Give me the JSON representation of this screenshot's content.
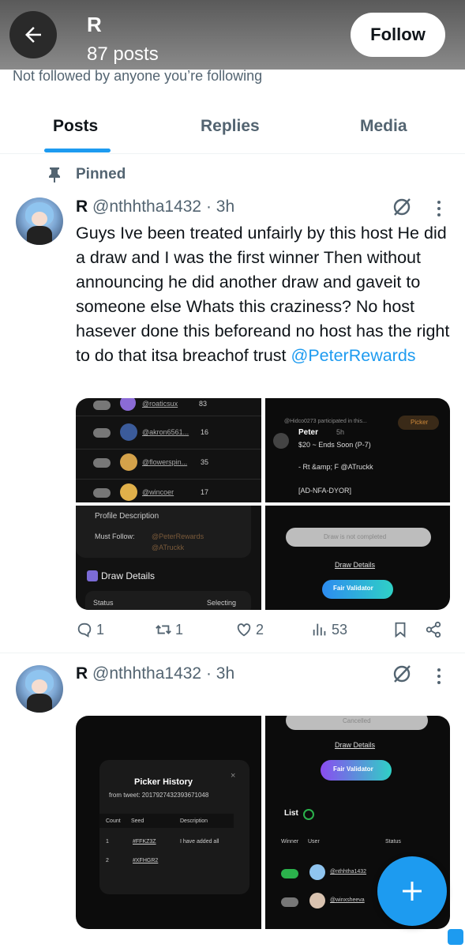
{
  "header": {
    "name": "R",
    "posts_count": "87 posts",
    "follow_label": "Follow",
    "not_followed": "Not followed by anyone you’re following"
  },
  "tabs": [
    {
      "label": "Posts",
      "active": true
    },
    {
      "label": "Replies",
      "active": false
    },
    {
      "label": "Media",
      "active": false
    }
  ],
  "pinned_label": "Pinned",
  "post1": {
    "name": "R",
    "handle_time": "@nthhtha1432 · 3h",
    "text": "Guys Ive been treated unfairly by this host He did a draw and I was the first winner Then without announcing he did another draw and gaveit to someone else Whats this craziness? No host hasever done this beforeand no host has the right to do that itsa breachof trust",
    "mention": "@PeterRewards",
    "media": {
      "list_users": [
        {
          "name": "@roaticsux",
          "count": "83"
        },
        {
          "name": "@akron6561...",
          "count": "16"
        },
        {
          "name": "@flowerspin...",
          "count": "35"
        },
        {
          "name": "@wincoer",
          "count": "17"
        }
      ],
      "participated": "@Hidco0273 participated in this...",
      "picker_label": "Picker",
      "peter_name": "Peter",
      "peter_time": "5h",
      "prize_line": "$20 ~ Ends Soon (P-7)",
      "rt_line": "- Rt &amp; F @ATruckk",
      "tag_line": "[AD-NFA-DYOR]",
      "profile_desc": "Profile Description",
      "must_follow_label": "Must Follow:",
      "must_follow_1": "@PeterRewards",
      "must_follow_2": "@ATruckk",
      "draw_details_title": "Draw Details",
      "status_label": "Status",
      "status_value": "Selecting",
      "draw_not_completed": "Draw is not completed",
      "draw_details_link": "Draw Details",
      "fair_validator": "Fair Validator"
    },
    "actions": {
      "replies": "1",
      "reposts": "1",
      "likes": "2",
      "views": "53"
    }
  },
  "post2": {
    "name": "R",
    "handle_time": "@nthhtha1432 · 3h",
    "media": {
      "picker_history_title": "Picker History",
      "from_tweet": "from tweet: 2017927432393671048",
      "col_count": "Count",
      "col_seed": "Seed",
      "col_desc": "Description",
      "rows": [
        {
          "count": "1",
          "seed": "#FFKZ3Z",
          "desc": "I have added all"
        },
        {
          "count": "2",
          "seed": "#XFHGR2",
          "desc": ""
        }
      ],
      "cancelled": "Cancelled",
      "draw_details_link": "Draw Details",
      "fair_validator": "Fair Validator",
      "list_label": "List",
      "col_winner": "Winner",
      "col_user": "User",
      "col_status": "Status",
      "winners": [
        "@nthhtha1432",
        "@winxsheeva"
      ]
    }
  },
  "colors": {
    "accent": "#1d9bf0",
    "text": "#0f1419",
    "muted": "#536471"
  }
}
